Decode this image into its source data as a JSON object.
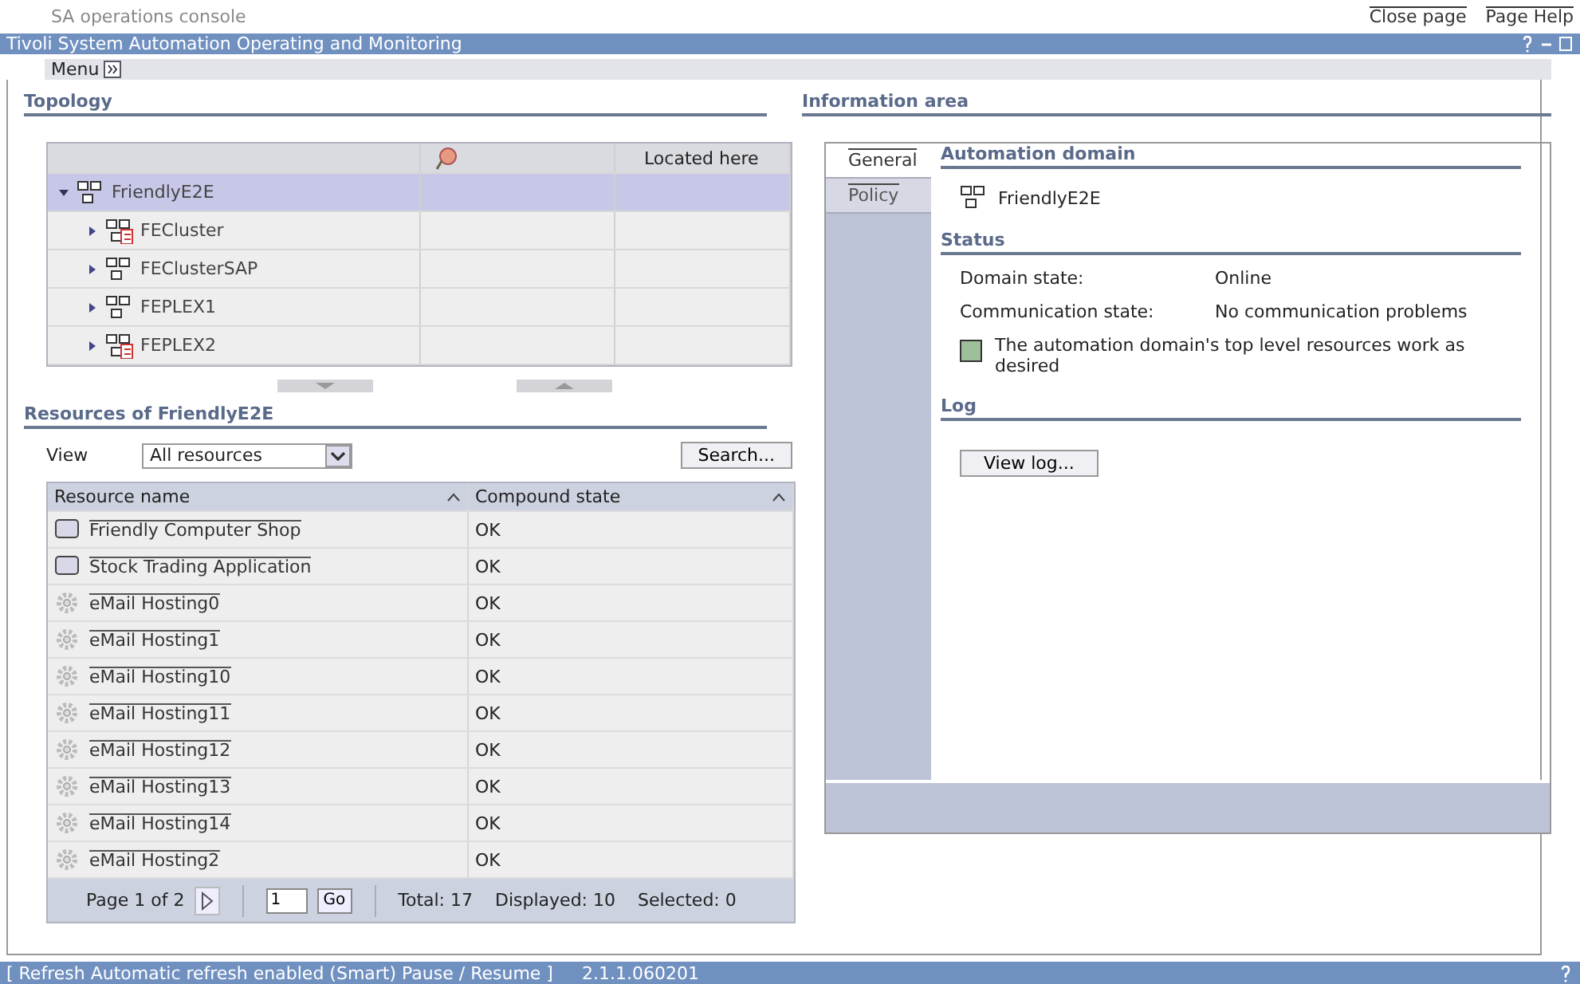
{
  "header": {
    "app_name": "SA operations console",
    "links": [
      "Close page",
      "Page Help"
    ]
  },
  "title_bar": {
    "title": "Tivoli System Automation Operating and Monitoring"
  },
  "menu": {
    "label": "Menu"
  },
  "topology": {
    "heading": "Topology",
    "located_column": "Located here",
    "tree": [
      {
        "label": "FriendlyE2E",
        "kind": "domain",
        "selected": true,
        "expanded": true,
        "children": [
          {
            "label": "FECluster",
            "kind": "domain-doc",
            "selected": false,
            "expanded": false
          },
          {
            "label": "FEClusterSAP",
            "kind": "domain",
            "selected": false,
            "expanded": false
          },
          {
            "label": "FEPLEX1",
            "kind": "domain",
            "selected": false,
            "expanded": false
          },
          {
            "label": "FEPLEX2",
            "kind": "domain-doc",
            "selected": false,
            "expanded": false
          }
        ]
      }
    ]
  },
  "resources": {
    "heading": "Resources of FriendlyE2E",
    "view_label": "View",
    "view_value": "All resources",
    "search_button": "Search...",
    "columns": [
      "Resource name",
      "Compound state"
    ],
    "rows": [
      {
        "name": "Friendly Computer Shop",
        "state": "OK",
        "kind": "application"
      },
      {
        "name": "Stock Trading Application",
        "state": "OK",
        "kind": "application"
      },
      {
        "name": "eMail Hosting0",
        "state": "OK",
        "kind": "group"
      },
      {
        "name": "eMail Hosting1",
        "state": "OK",
        "kind": "group"
      },
      {
        "name": "eMail Hosting10",
        "state": "OK",
        "kind": "group"
      },
      {
        "name": "eMail Hosting11",
        "state": "OK",
        "kind": "group"
      },
      {
        "name": "eMail Hosting12",
        "state": "OK",
        "kind": "group"
      },
      {
        "name": "eMail Hosting13",
        "state": "OK",
        "kind": "group"
      },
      {
        "name": "eMail Hosting14",
        "state": "OK",
        "kind": "group"
      },
      {
        "name": "eMail Hosting2",
        "state": "OK",
        "kind": "group"
      }
    ],
    "pager": {
      "page": "Page 1 of 2",
      "page_input": "1",
      "go": "Go",
      "total": "Total: 17",
      "displayed": "Displayed: 10",
      "selected": "Selected: 0"
    }
  },
  "info": {
    "heading": "Information area",
    "tabs": [
      {
        "label": "General",
        "selected": true
      },
      {
        "label": "Policy",
        "selected": false
      }
    ],
    "domain_heading": "Automation domain",
    "domain_name": "FriendlyE2E",
    "status_heading": "Status",
    "fields": [
      {
        "label": "Domain state:",
        "value": "Online"
      },
      {
        "label": "Communication state:",
        "value": "No communication problems"
      }
    ],
    "status_message": "The automation domain's top level resources work as desired",
    "log_heading": "Log",
    "view_log_button": "View log..."
  },
  "status_bar": {
    "refresh": "[ Refresh  Automatic refresh enabled (Smart)  Pause / Resume ]",
    "version": "2.1.1.060201"
  }
}
